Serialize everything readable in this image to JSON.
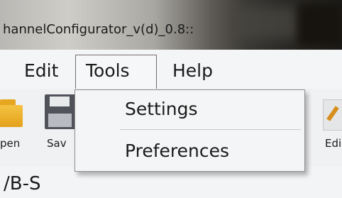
{
  "window": {
    "title": "hannelConfigurator_v(d)_0.8::"
  },
  "menubar": {
    "items": [
      "Edit",
      "Tools",
      "Help"
    ]
  },
  "tools_menu": {
    "items": [
      "Settings",
      "Preferences"
    ]
  },
  "toolbar": {
    "open_label": "pen",
    "save_label": "Sav",
    "edit_label": "Edi"
  },
  "content": {
    "text": "/B-S"
  },
  "colors": {
    "folder": "#e9a826",
    "floppy": "#50545a",
    "menu_border": "#8e8e8e"
  }
}
